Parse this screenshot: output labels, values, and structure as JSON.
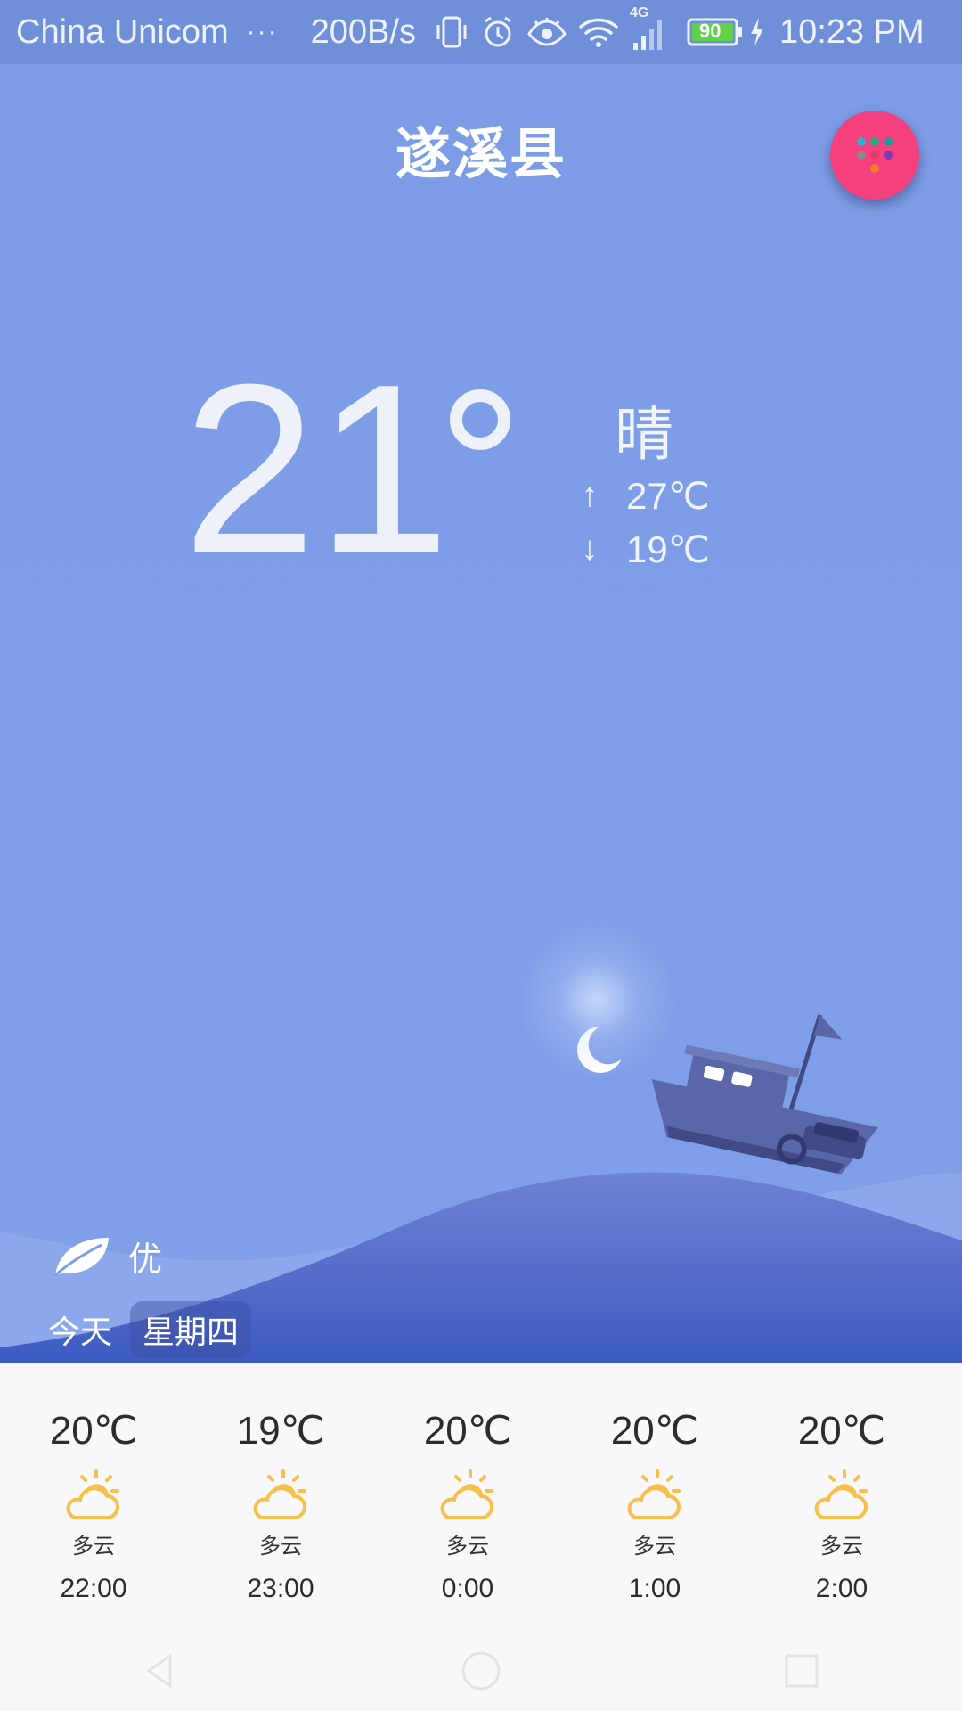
{
  "status_bar": {
    "carrier": "China Unicom",
    "more": "···",
    "net_speed": "200B/s",
    "network_type": "4G",
    "battery": "90",
    "time": "10:23 PM",
    "icons": [
      "vibrate-icon",
      "alarm-icon",
      "eye-icon",
      "wifi-icon",
      "signal-icon",
      "battery-icon",
      "charging-icon"
    ]
  },
  "header": {
    "city": "遂溪县",
    "fab_icon": "apps-grid-icon",
    "fab_color": "#f4407c"
  },
  "current": {
    "temperature": "21",
    "condition": "晴",
    "high_arrow": "↑",
    "high": "27℃",
    "low_arrow": "↓",
    "low": "19℃"
  },
  "air_quality": {
    "icon": "leaf-icon",
    "label": "优"
  },
  "day": {
    "today_label": "今天",
    "weekday": "星期四"
  },
  "hourly": [
    {
      "temp": "20℃",
      "icon": "partly-cloudy-icon",
      "condition": "多云",
      "time": "22:00"
    },
    {
      "temp": "19℃",
      "icon": "partly-cloudy-icon",
      "condition": "多云",
      "time": "23:00"
    },
    {
      "temp": "20℃",
      "icon": "partly-cloudy-icon",
      "condition": "多云",
      "time": "0:00"
    },
    {
      "temp": "20℃",
      "icon": "partly-cloudy-icon",
      "condition": "多云",
      "time": "1:00"
    },
    {
      "temp": "20℃",
      "icon": "partly-cloudy-icon",
      "condition": "多云",
      "time": "2:00"
    }
  ],
  "colors": {
    "sky": "#7e9ee8",
    "wave_dark": "#3f5cc0",
    "sun_icon": "#f7c04a"
  }
}
